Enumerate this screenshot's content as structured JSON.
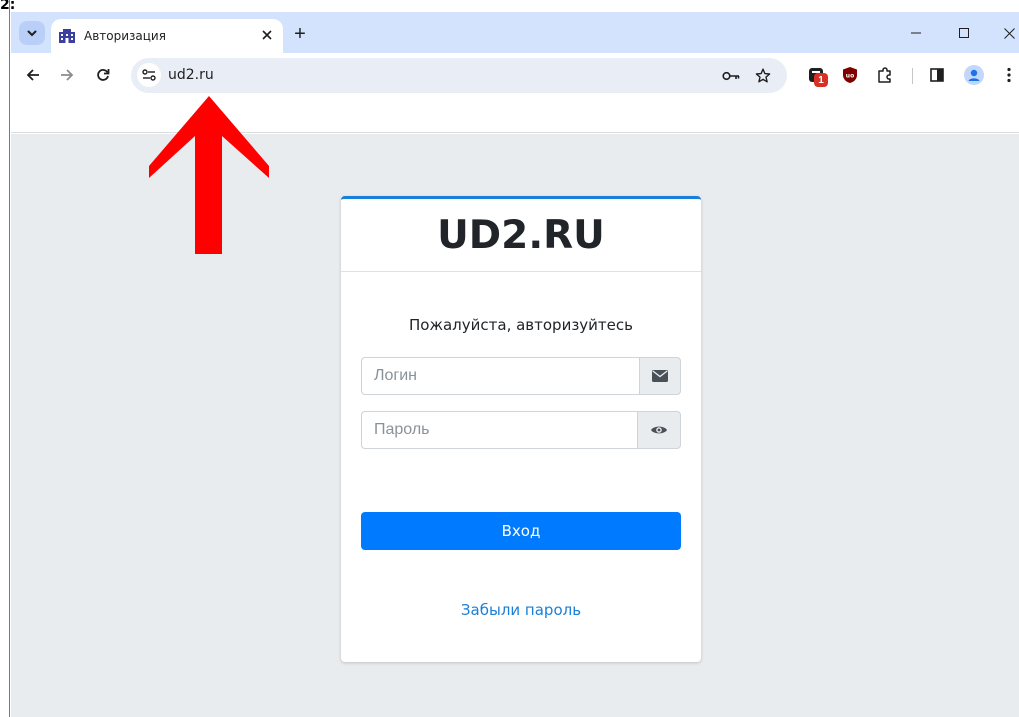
{
  "corner_mark": "2:",
  "browser": {
    "tab": {
      "title": "Авторизация",
      "favicon": "building-icon"
    },
    "new_tab_label": "+",
    "address_bar": {
      "url": "ud2.ru"
    },
    "extension_badge": "1",
    "icons": [
      "tab-search-icon",
      "back-icon",
      "forward-icon",
      "reload-icon",
      "site-info-icon",
      "key-icon",
      "star-icon",
      "extension-icon",
      "ublock-icon",
      "puzzle-icon",
      "side-panel-icon",
      "profile-icon",
      "menu-icon",
      "minimize-icon",
      "maximize-icon",
      "close-icon"
    ]
  },
  "annotation": {
    "arrow_color": "#ff0000"
  },
  "login": {
    "brand": "UD2.RU",
    "prompt": "Пожалуйста, авторизуйтесь",
    "login_placeholder": "Логин",
    "password_placeholder": "Пароль",
    "submit_label": "Вход",
    "forgot_label": "Забыли пароль",
    "colors": {
      "primary": "#007bff",
      "accent_border": "#1a7fd9",
      "background": "#e9ecef"
    }
  }
}
